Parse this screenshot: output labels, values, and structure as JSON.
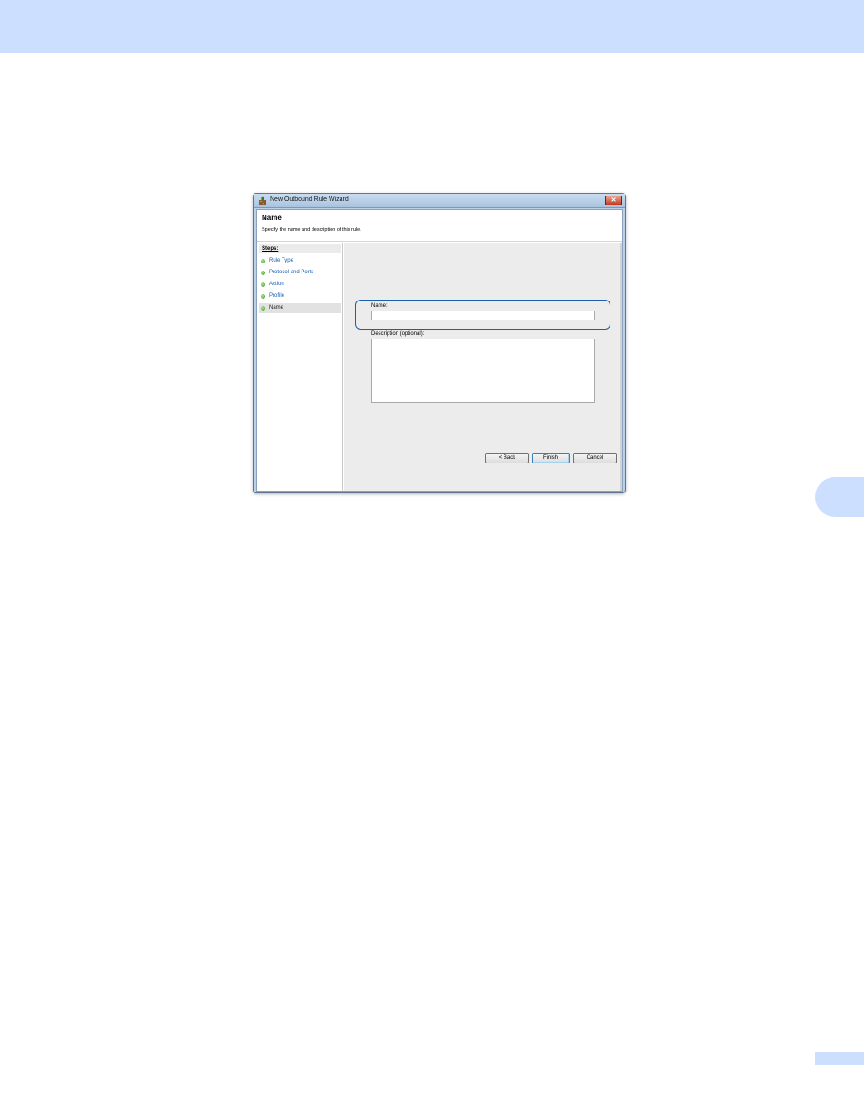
{
  "window": {
    "title": "New Outbound Rule Wizard",
    "close_glyph": "✕"
  },
  "header": {
    "title": "Name",
    "subtitle": "Specify the name and description of this rule."
  },
  "steps": {
    "label": "Steps:",
    "items": [
      {
        "label": "Rule Type"
      },
      {
        "label": "Protocol and Ports"
      },
      {
        "label": "Action"
      },
      {
        "label": "Profile"
      },
      {
        "label": "Name"
      }
    ]
  },
  "form": {
    "name_label": "Name:",
    "name_value": "",
    "description_label": "Description (optional):",
    "description_value": ""
  },
  "buttons": {
    "back": "< Back",
    "finish": "Finish",
    "cancel": "Cancel"
  },
  "colors": {
    "page_header": "#cddfff",
    "highlight": "#1d5fa8",
    "step_link": "#1c5fb4"
  },
  "icons": {
    "app": "firewall-wizard-icon",
    "step": "green-bullet-icon",
    "close": "close-icon"
  }
}
